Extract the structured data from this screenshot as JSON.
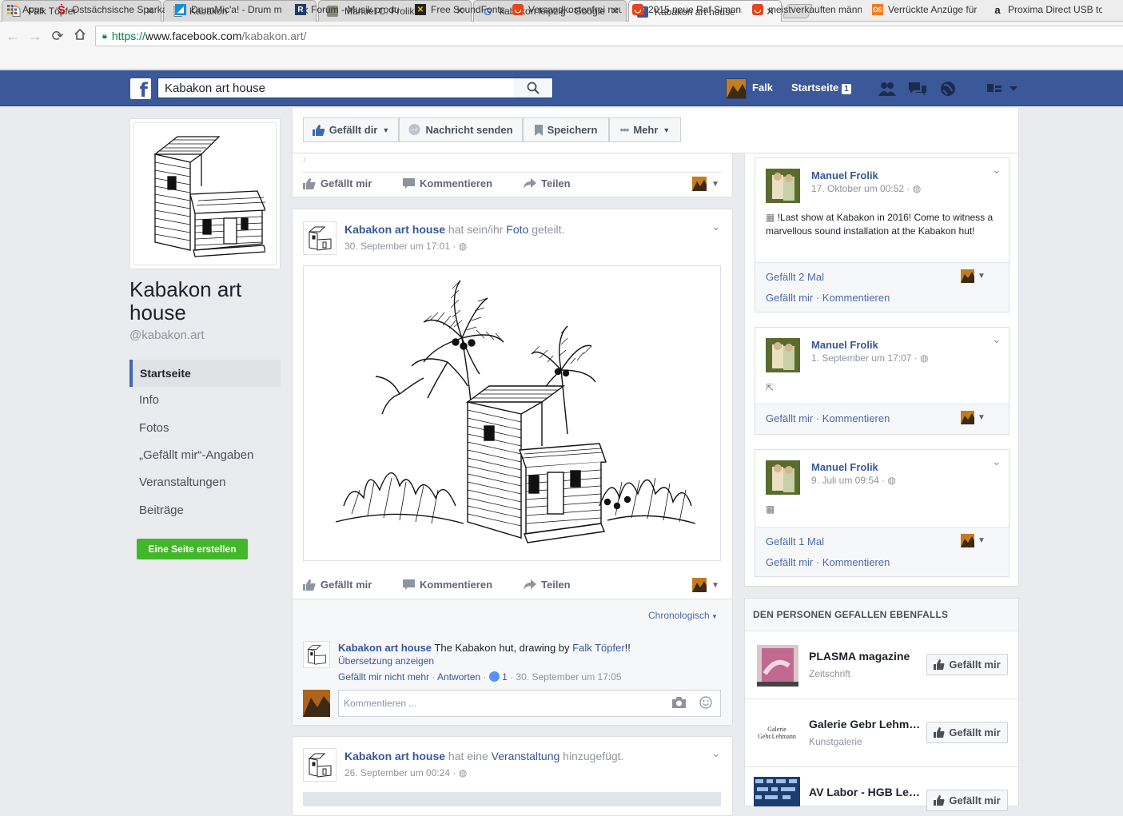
{
  "browser": {
    "tabs": [
      {
        "title": "Falk Töpfer"
      },
      {
        "title": "Kabakon"
      },
      {
        "title": "Manuel C. Frolik"
      },
      {
        "title": "kabakon leipzig - Google"
      },
      {
        "title": "Kabakon art house"
      }
    ],
    "url": {
      "proto": "https://",
      "host": "www.facebook.com",
      "path": "/kabakon.art/"
    },
    "bookmarks": [
      {
        "label": "Apps"
      },
      {
        "label": "Ostsächsische Sparkas"
      },
      {
        "label": "DrumMic'a! - Drum m"
      },
      {
        "label": "Forum - Musik produ"
      },
      {
        "label": "Free SoundFonts"
      },
      {
        "label": "Versandkostenfrei neu"
      },
      {
        "label": "2015 neue Raf Simons"
      },
      {
        "label": "meistverkauften männ"
      },
      {
        "label": "Verrückte Anzüge für"
      },
      {
        "label": "Proxima Direct USB to"
      }
    ]
  },
  "fb": {
    "search_value": "Kabakon art house",
    "user_name": "Falk",
    "home_label": "Startseite",
    "home_badge": "1"
  },
  "page": {
    "name": "Kabakon art house",
    "handle": "@kabakon.art",
    "nav": [
      "Startseite",
      "Info",
      "Fotos",
      "„Gefällt mir“-Angaben",
      "Veranstaltungen",
      "Beiträge"
    ],
    "create_page": "Eine Seite erstellen"
  },
  "actions": {
    "like": "Gefällt dir",
    "message": "Nachricht senden",
    "save": "Speichern",
    "more": "Mehr"
  },
  "post_actions": {
    "like": "Gefällt mir",
    "comment": "Kommentieren",
    "share": "Teilen"
  },
  "post1": {
    "author": "Kabakon art house",
    "verb": "hat sein/ihr",
    "object": "Foto",
    "suffix": "geteilt.",
    "time": "30. September um 17:01 ·",
    "sort": "Chronologisch",
    "comment": {
      "author": "Kabakon art house",
      "text": "The Kabakon hut, drawing by",
      "mention": "Falk Töpfer",
      "after": "!!",
      "translate": "Übersetzung anzeigen",
      "unlike": "Gefällt mir nicht mehr",
      "reply": "Antworten",
      "likes": "1",
      "time": "30. September um 17:05"
    },
    "comment_placeholder": "Kommentieren ..."
  },
  "post2": {
    "author": "Kabakon art house",
    "verb": "hat eine",
    "object": "Veranstaltung",
    "suffix": "hinzugefügt.",
    "time": "26. September um 00:24 ·"
  },
  "right_posts": [
    {
      "name": "Manuel Frolik",
      "time": "17. Oktober um 00:52 ·",
      "text": "!Last show at Kabakon in 2016! Come to witness a marvellous sound installation at the Kabakon hut!",
      "likes": "Gefällt 2 Mal",
      "like": "Gefällt mir",
      "comment": "Kommentieren"
    },
    {
      "name": "Manuel Frolik",
      "time": "1. September um 17:07 ·",
      "like": "Gefällt mir",
      "comment": "Kommentieren"
    },
    {
      "name": "Manuel Frolik",
      "time": "9. Juli um 09:54 ·",
      "likes": "Gefällt 1 Mal",
      "like": "Gefällt mir",
      "comment": "Kommentieren"
    }
  ],
  "suggestions": {
    "header": "DEN PERSONEN GEFALLEN EBENFALLS",
    "button": "Gefällt mir",
    "items": [
      {
        "name": "PLASMA magazine",
        "category": "Zeitschrift"
      },
      {
        "name": "Galerie Gebr Lehmann",
        "category": "Kunstgalerie",
        "logo": "Galerie Gebr.Lehmann"
      },
      {
        "name": "AV Labor - HGB Leipzig",
        "category": ""
      }
    ]
  },
  "colors": {
    "fb_blue": "#3b5998",
    "link": "#365899",
    "green": "#42b72a"
  }
}
